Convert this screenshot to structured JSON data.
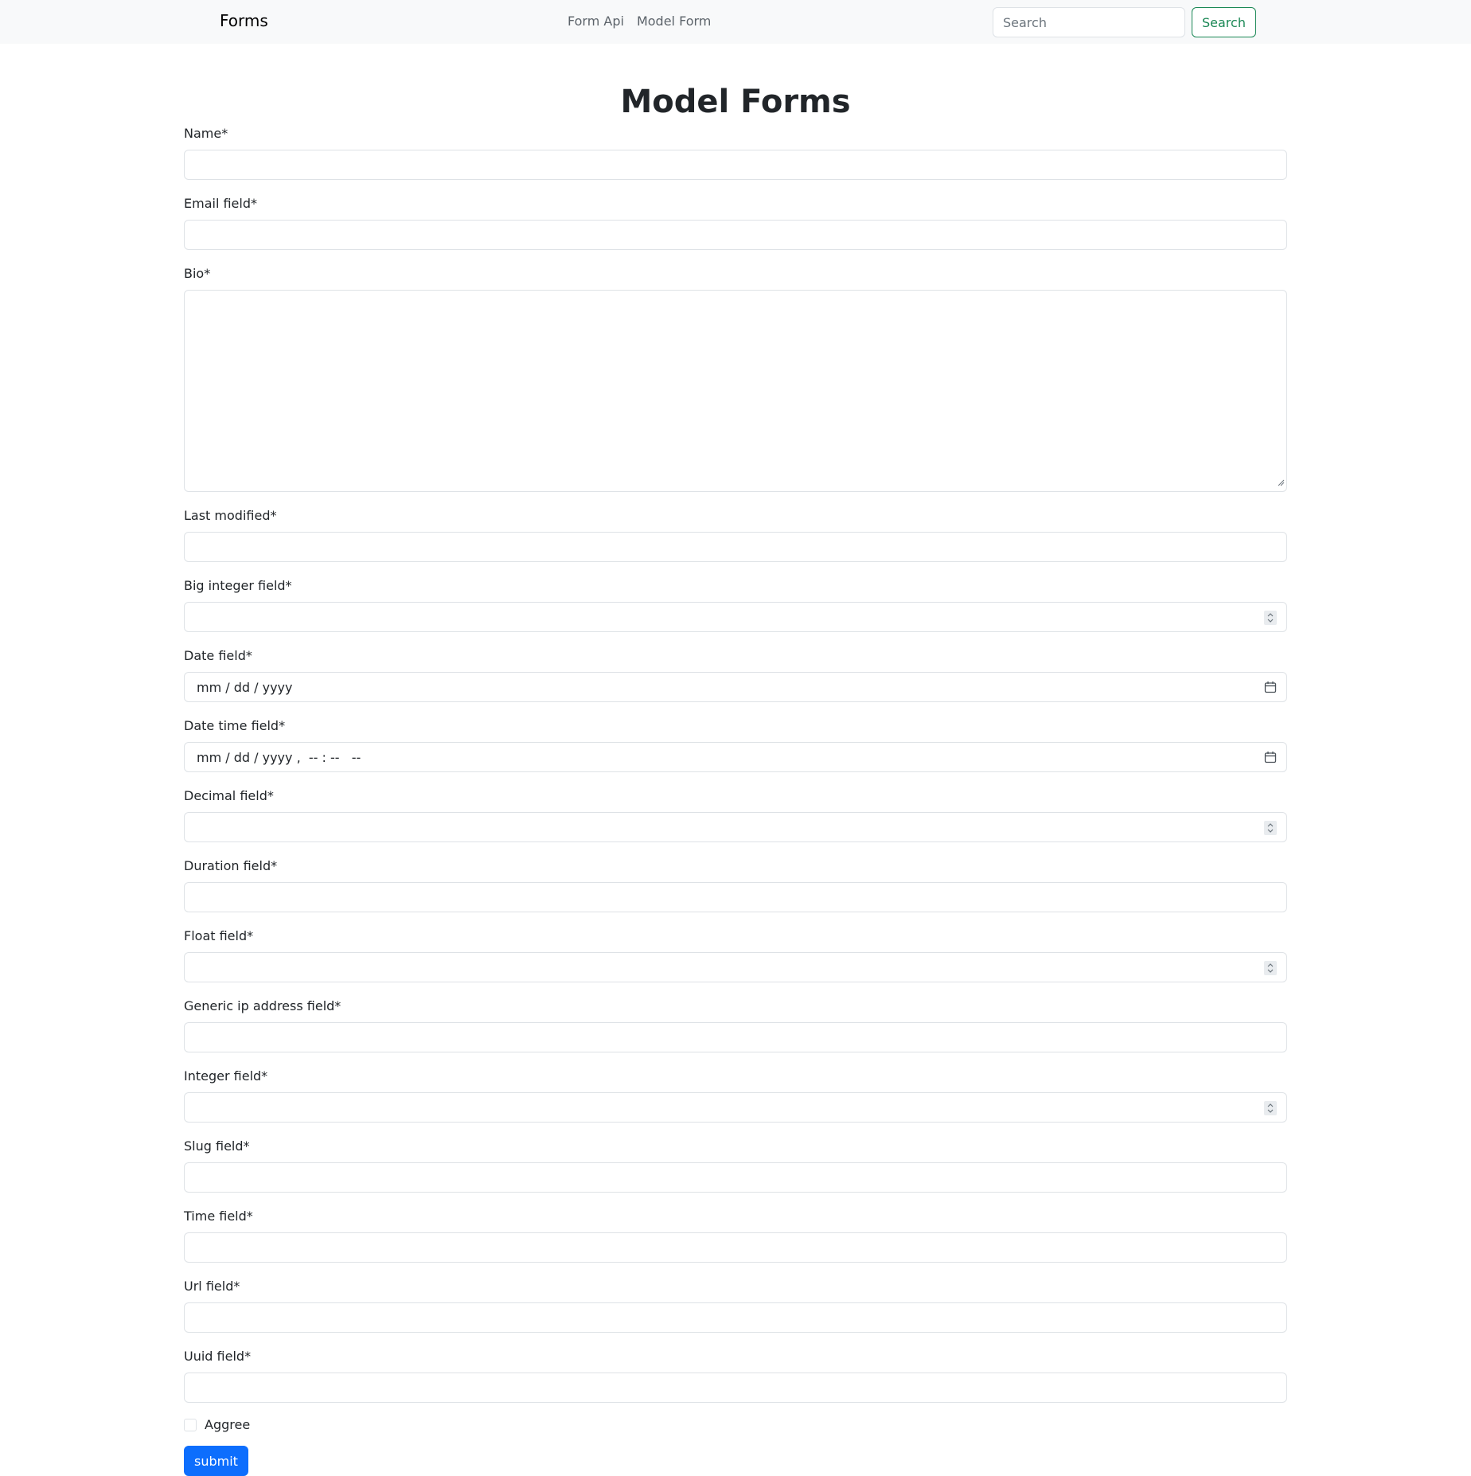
{
  "navbar": {
    "brand": "Forms",
    "links": [
      "Form Api",
      "Model Form"
    ],
    "search_placeholder": "Search",
    "search_button": "Search"
  },
  "page": {
    "title": "Model Forms"
  },
  "fields": [
    {
      "label": "Name*",
      "type": "text"
    },
    {
      "label": "Email field*",
      "type": "text"
    },
    {
      "label": "Bio*",
      "type": "textarea"
    },
    {
      "label": "Last modified*",
      "type": "text"
    },
    {
      "label": "Big integer field*",
      "type": "number"
    },
    {
      "label": "Date field*",
      "type": "date",
      "placeholder": "mm / dd / yyyy"
    },
    {
      "label": "Date time field*",
      "type": "datetime",
      "placeholder": "mm / dd / yyyy ,  -- : --   --"
    },
    {
      "label": "Decimal field*",
      "type": "number"
    },
    {
      "label": "Duration field*",
      "type": "text"
    },
    {
      "label": "Float field*",
      "type": "number"
    },
    {
      "label": "Generic ip address field*",
      "type": "text"
    },
    {
      "label": "Integer field*",
      "type": "number"
    },
    {
      "label": "Slug field*",
      "type": "text"
    },
    {
      "label": "Time field*",
      "type": "text"
    },
    {
      "label": "Url field*",
      "type": "text"
    },
    {
      "label": "Uuid field*",
      "type": "text"
    }
  ],
  "agree_label": "Aggree",
  "submit_label": "submit"
}
